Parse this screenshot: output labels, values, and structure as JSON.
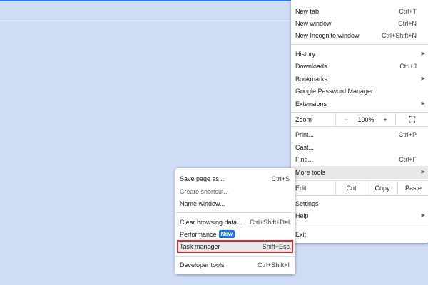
{
  "main_menu": {
    "new_tab": {
      "label": "New tab",
      "shortcut": "Ctrl+T"
    },
    "new_window": {
      "label": "New window",
      "shortcut": "Ctrl+N"
    },
    "new_incognito": {
      "label": "New Incognito window",
      "shortcut": "Ctrl+Shift+N"
    },
    "history": {
      "label": "History"
    },
    "downloads": {
      "label": "Downloads",
      "shortcut": "Ctrl+J"
    },
    "bookmarks": {
      "label": "Bookmarks"
    },
    "password_manager": {
      "label": "Google Password Manager"
    },
    "extensions": {
      "label": "Extensions"
    },
    "zoom": {
      "label": "Zoom",
      "minus": "−",
      "level": "100%",
      "plus": "+",
      "fullscreen": "⛶"
    },
    "print": {
      "label": "Print...",
      "shortcut": "Ctrl+P"
    },
    "cast": {
      "label": "Cast..."
    },
    "find": {
      "label": "Find...",
      "shortcut": "Ctrl+F"
    },
    "more_tools": {
      "label": "More tools"
    },
    "edit": {
      "label": "Edit",
      "cut": "Cut",
      "copy": "Copy",
      "paste": "Paste"
    },
    "settings": {
      "label": "Settings"
    },
    "help": {
      "label": "Help"
    },
    "exit": {
      "label": "Exit"
    },
    "submenu_arrow": "▶"
  },
  "sub_menu": {
    "save_page": {
      "label": "Save page as...",
      "shortcut": "Ctrl+S"
    },
    "create_shortcut": {
      "label": "Create shortcut..."
    },
    "name_window": {
      "label": "Name window..."
    },
    "clear_data": {
      "label": "Clear browsing data...",
      "shortcut": "Ctrl+Shift+Del"
    },
    "performance": {
      "label": "Performance",
      "badge": "New"
    },
    "task_manager": {
      "label": "Task manager",
      "shortcut": "Shift+Esc"
    },
    "developer_tools": {
      "label": "Developer tools",
      "shortcut": "Ctrl+Shift+I"
    }
  },
  "colors": {
    "background": "#cfdcf6",
    "accent": "#1a73e8",
    "highlight_border": "#d32f2f"
  }
}
